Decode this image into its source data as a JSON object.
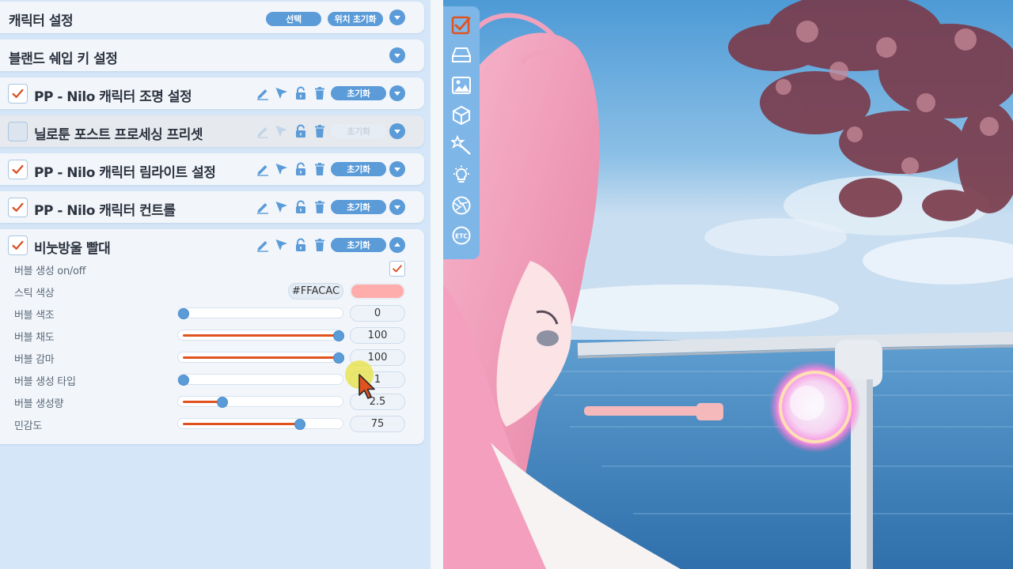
{
  "sections": [
    {
      "title": "캐릭터 설정",
      "buttons": [
        "선택",
        "위치 초기화"
      ]
    },
    {
      "title": "블랜드 쉐입 키 설정"
    },
    {
      "title": "PP - Nilo 캐릭터 조명 설정",
      "reset": "초기화",
      "checked": true
    },
    {
      "title": "닐로툰 포스트 프로세싱 프리셋",
      "reset": "초기화",
      "checked": false
    },
    {
      "title": "PP - Nilo 캐릭터 림라이트 설정",
      "reset": "초기화",
      "checked": true
    },
    {
      "title": "PP - Nilo 캐릭터 컨트롤",
      "reset": "초기화",
      "checked": true
    }
  ],
  "bubble": {
    "title": "비눗방울 빨대",
    "reset": "초기화",
    "checked": true,
    "toggle_label": "버블 생성 on/off",
    "toggle_on": true,
    "stick_color_label": "스틱 색상",
    "stick_color_hex": "#FFACAC",
    "sliders": [
      {
        "label": "버블 색조",
        "value": "0",
        "fraction": 0.0
      },
      {
        "label": "버블 채도",
        "value": "100",
        "fraction": 1.0
      },
      {
        "label": "버블 감마",
        "value": "100",
        "fraction": 1.0
      },
      {
        "label": "버블 생성 타입",
        "value": "1",
        "fraction": 0.0
      },
      {
        "label": "버블 생성량",
        "value": "2.5",
        "fraction": 0.25
      },
      {
        "label": "민감도",
        "value": "75",
        "fraction": 0.75
      }
    ]
  },
  "colors": {
    "accent": "#5a9bd8",
    "slider_fill": "#e0531f",
    "check": "#d9532a",
    "toolbar": "#7fb6e8",
    "active_tool": "#e0531f"
  },
  "toolbar_icons": [
    "checklist-icon",
    "drive-icon",
    "image-icon",
    "cube-icon",
    "magic-wand-icon",
    "lightbulb-icon",
    "aperture-icon",
    "etc-icon"
  ],
  "toolbar_etc": "ETC"
}
